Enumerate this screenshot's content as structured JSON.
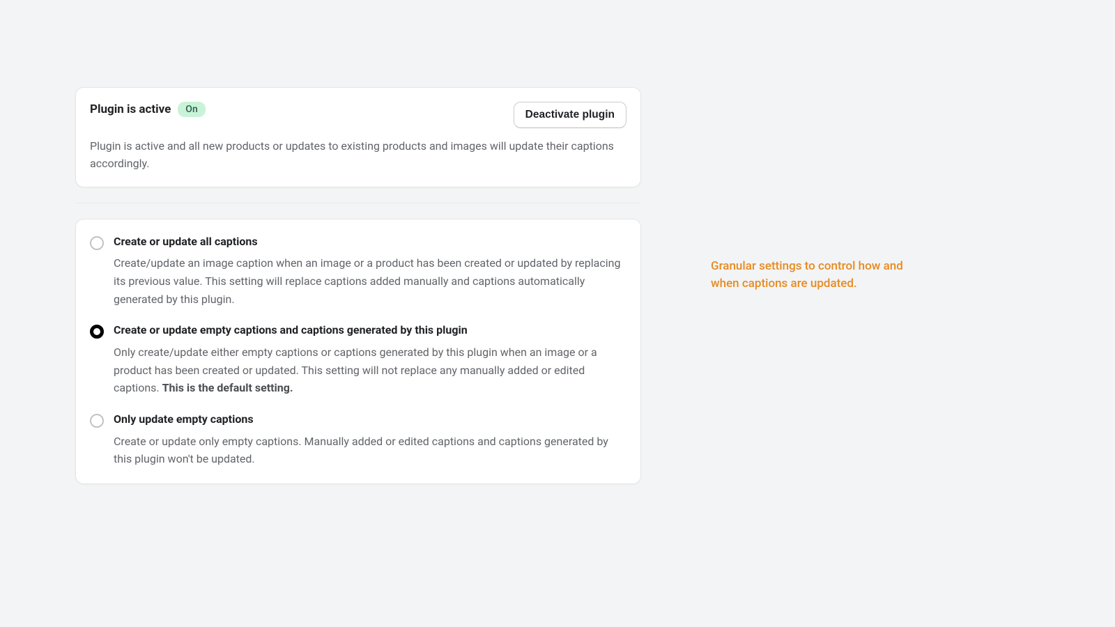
{
  "status": {
    "title": "Plugin is active",
    "badge": "On",
    "deactivate_label": "Deactivate plugin",
    "description": "Plugin is active and all new products or updates to existing products and images will update their captions accordingly."
  },
  "options": [
    {
      "selected": false,
      "title": "Create or update all captions",
      "description": "Create/update an image caption when an image or a product has been created or updated by replacing its previous value. This setting will replace captions added manually and captions automatically generated by this plugin."
    },
    {
      "selected": true,
      "title": "Create or update empty captions and captions generated by this plugin",
      "description": "Only create/update either empty captions or captions generated by this plugin when an image or a product has been created or updated. This setting will not replace any manually added or edited captions. ",
      "description_strong": "This is the default setting."
    },
    {
      "selected": false,
      "title": "Only update empty captions",
      "description": "Create or update only empty captions. Manually added or edited captions and captions generated by this plugin won't be updated."
    }
  ],
  "annotation": "Granular settings to control how and when captions are updated."
}
